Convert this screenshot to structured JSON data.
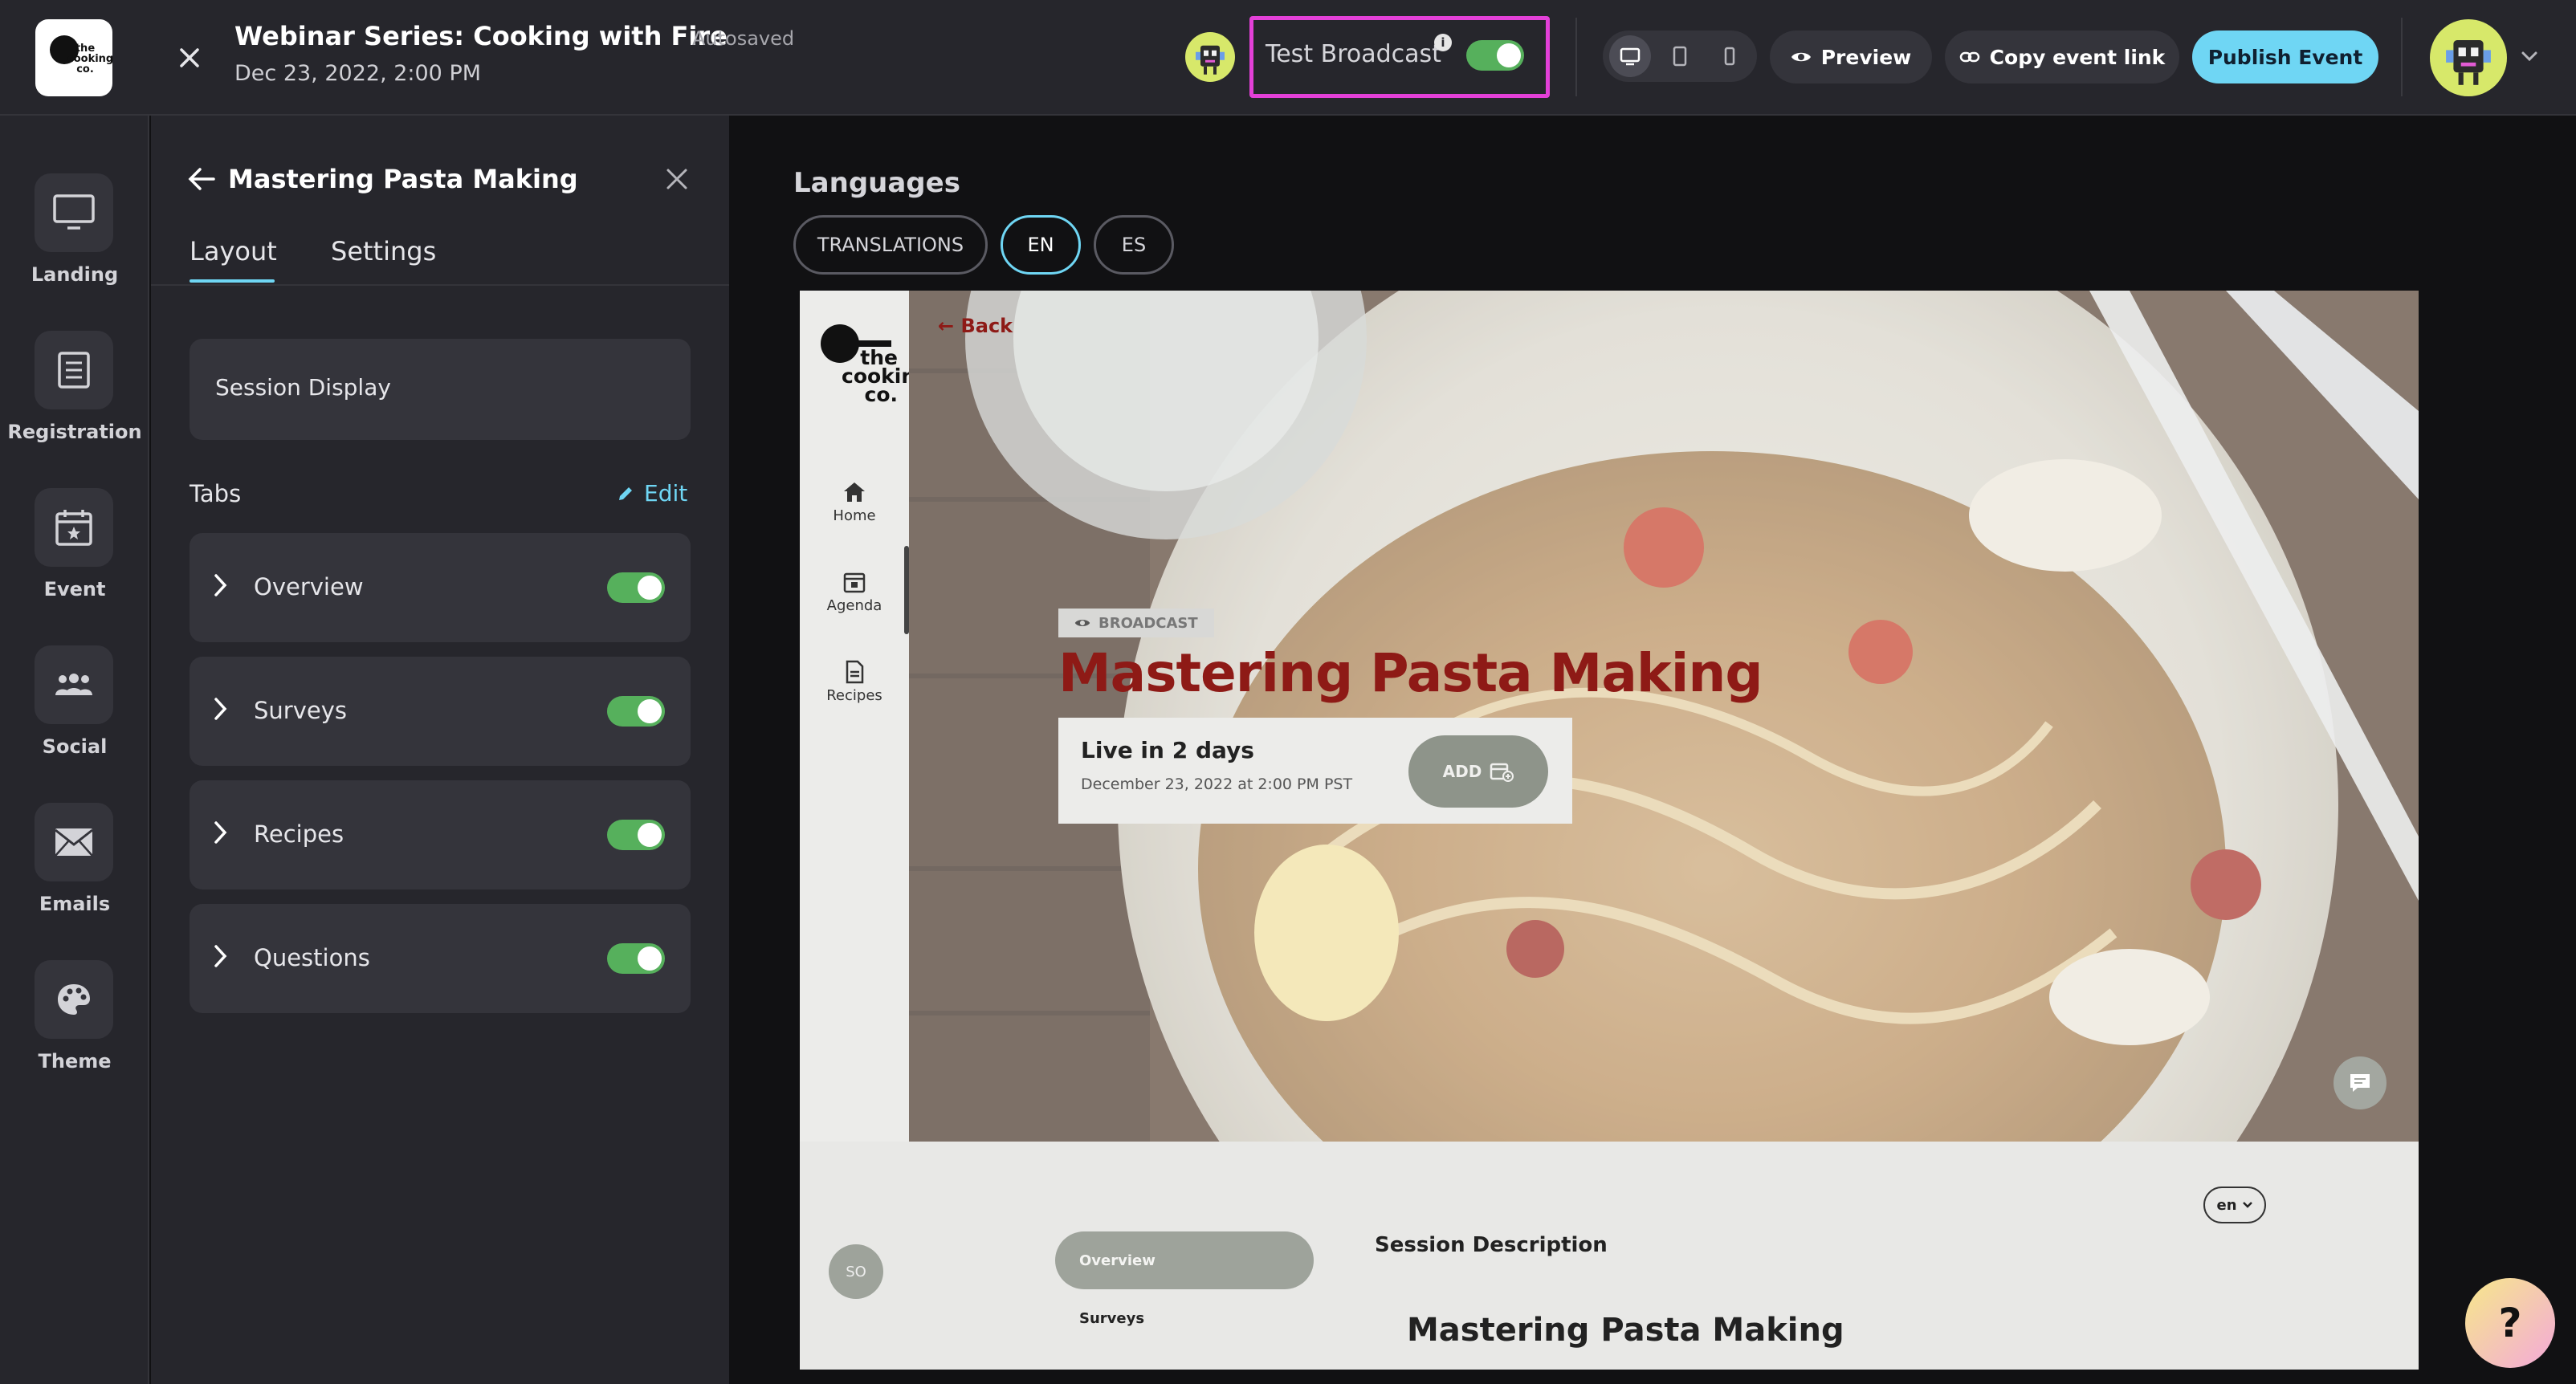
{
  "header": {
    "logo_text": "the cooking co.",
    "title": "Webinar Series: Cooking with Fire",
    "autosaved": "Autosaved",
    "date": "Dec 23, 2022, 2:00 PM",
    "test_broadcast_label": "Test Broadcast",
    "test_broadcast_on": true,
    "info_glyph": "i",
    "preview_label": "Preview",
    "copy_link_label": "Copy event link",
    "publish_label": "Publish Event"
  },
  "nav": {
    "items": [
      {
        "label": "Landing",
        "icon": "monitor-icon"
      },
      {
        "label": "Registration",
        "icon": "list-icon"
      },
      {
        "label": "Event",
        "icon": "calendar-icon"
      },
      {
        "label": "Social",
        "icon": "people-icon"
      },
      {
        "label": "Emails",
        "icon": "envelope-icon"
      },
      {
        "label": "Theme",
        "icon": "palette-icon"
      }
    ]
  },
  "panel": {
    "title": "Mastering Pasta Making",
    "tabs": [
      "Layout",
      "Settings"
    ],
    "session_display": "Session Display",
    "tabs_label": "Tabs",
    "edit_label": "Edit",
    "tab_rows": [
      {
        "label": "Overview",
        "enabled": true
      },
      {
        "label": "Surveys",
        "enabled": true
      },
      {
        "label": "Recipes",
        "enabled": true
      },
      {
        "label": "Questions",
        "enabled": true
      }
    ]
  },
  "canvas": {
    "languages_label": "Languages",
    "translations_label": "TRANSLATIONS",
    "lang_en": "EN",
    "lang_es": "ES"
  },
  "preview": {
    "logo_text": "the cooking co.",
    "nav": [
      "Home",
      "Agenda",
      "Recipes"
    ],
    "back_label": "Back",
    "badge": "BROADCAST",
    "title": "Mastering Pasta Making",
    "live_title": "Live in 2 days",
    "live_date": "December 23, 2022 at 2:00 PM PST",
    "add_label": "ADD",
    "lang_select": "en",
    "avatar_initials": "SO",
    "tab_overview": "Overview",
    "tab_surveys": "Surveys",
    "session_description": "Session Description",
    "session_title": "Mastering Pasta Making"
  },
  "help_glyph": "?",
  "colors": {
    "accent": "#6fd6f4",
    "toggle_on": "#56b05c",
    "highlight": "#e340d8",
    "brand_red": "#8e1a16"
  }
}
